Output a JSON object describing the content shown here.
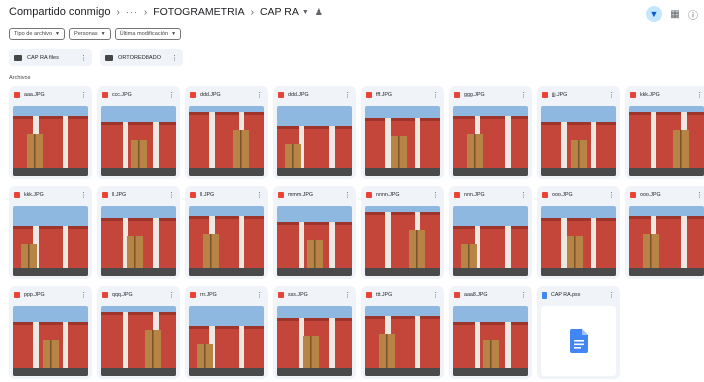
{
  "breadcrumb": {
    "items": [
      "Compartido conmigo",
      "FOTOGRAMETRIA",
      "CAP RA"
    ],
    "overflow": "···"
  },
  "toolbar": {
    "icons": [
      "list-view-icon",
      "info-icon",
      "settings-icon"
    ]
  },
  "filters": [
    {
      "label": "Tipo de archivo"
    },
    {
      "label": "Personas"
    },
    {
      "label": "Última modificación"
    }
  ],
  "folders": [
    {
      "name": "CAP RA files"
    },
    {
      "name": "ORTORED8ADO"
    }
  ],
  "files_section_label": "Archivos",
  "files": [
    {
      "name": "aaa.JPG",
      "kind": "image"
    },
    {
      "name": "ccc.JPG",
      "kind": "image"
    },
    {
      "name": "ddd.JPG",
      "kind": "image"
    },
    {
      "name": "ddd.JPG",
      "kind": "image"
    },
    {
      "name": "fff.JPG",
      "kind": "image"
    },
    {
      "name": "ggg.JPG",
      "kind": "image"
    },
    {
      "name": "jjj.JPG",
      "kind": "image"
    },
    {
      "name": "kkk.JPG",
      "kind": "image"
    },
    {
      "name": "kkk.JPG",
      "kind": "image"
    },
    {
      "name": "ll.JPG",
      "kind": "image"
    },
    {
      "name": "ll.JPG",
      "kind": "image"
    },
    {
      "name": "mmm.JPG",
      "kind": "image"
    },
    {
      "name": "nnnn.JPG",
      "kind": "image"
    },
    {
      "name": "nnn.JPG",
      "kind": "image"
    },
    {
      "name": "ooo.JPG",
      "kind": "image"
    },
    {
      "name": "ooo.JPG",
      "kind": "image"
    },
    {
      "name": "ppp.JPG",
      "kind": "image"
    },
    {
      "name": "qqq.JPG",
      "kind": "image"
    },
    {
      "name": "rrr.JPG",
      "kind": "image"
    },
    {
      "name": "sss.JPG",
      "kind": "image"
    },
    {
      "name": "ttt.JPG",
      "kind": "image"
    },
    {
      "name": "aaa8.JPG",
      "kind": "image"
    },
    {
      "name": "CAP RA.psx",
      "kind": "doc"
    }
  ],
  "colors": {
    "wall": "#c4463a",
    "wall_dark": "#9e352c",
    "sky": "#8fb8e0",
    "pilaster": "#ece8e2",
    "door": "#b88446",
    "base": "#4a4a4a",
    "accent": "#0b57d0",
    "card_bg": "#f0f4f9"
  }
}
